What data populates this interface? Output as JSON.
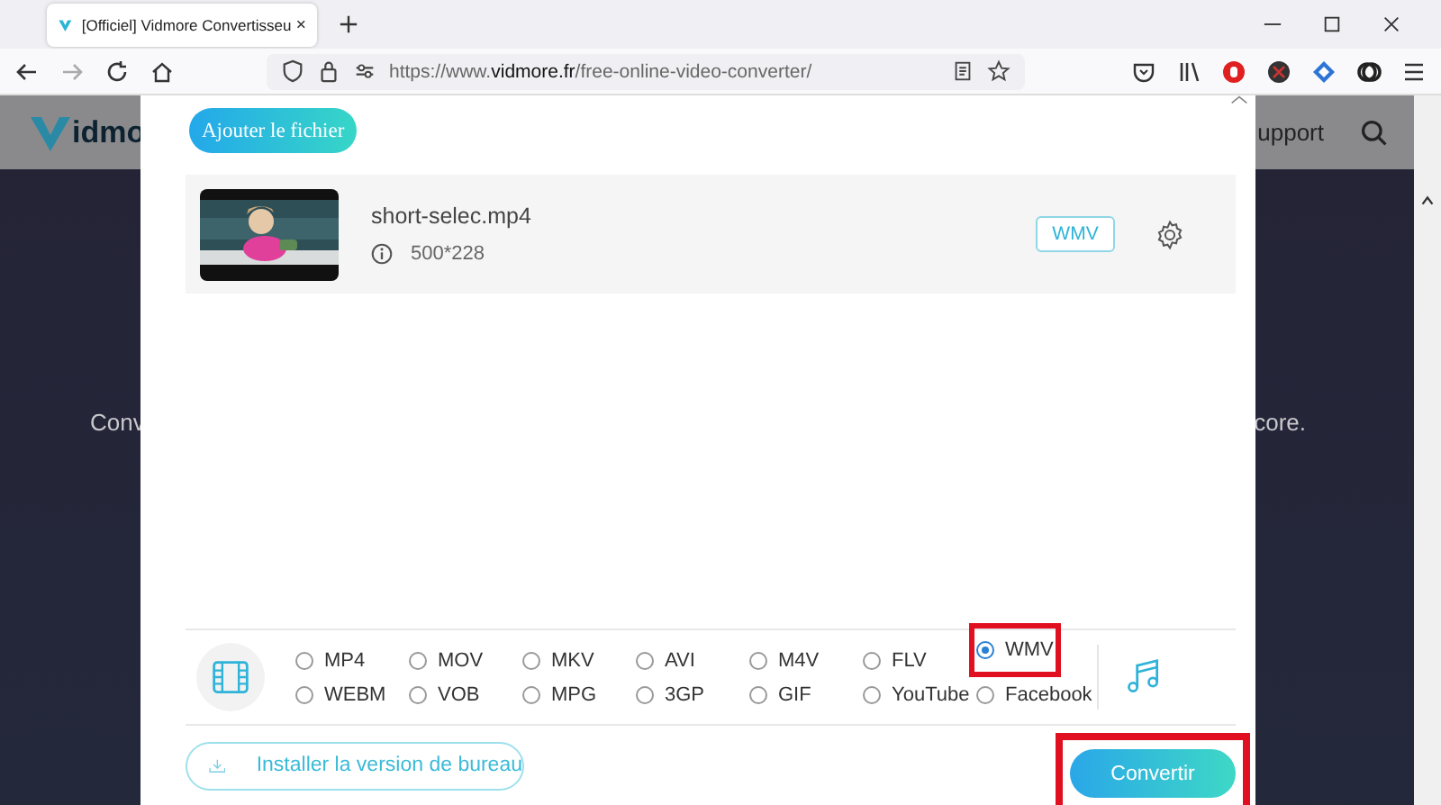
{
  "browser": {
    "tab_title": "[Officiel] Vidmore Convertisseu",
    "url_prefix": "https://www.",
    "url_domain": "vidmore.fr",
    "url_path": "/free-online-video-converter/"
  },
  "site": {
    "logo_text": "idmo",
    "nav_text": "upport",
    "left_text": "Conv",
    "right_text": "core."
  },
  "dialog": {
    "add_button": "Ajouter le fichier",
    "file": {
      "name": "short-selec.mp4",
      "resolution": "500*228",
      "format": "WMV"
    },
    "formats": [
      {
        "label": "MP4",
        "selected": false,
        "highlighted": false
      },
      {
        "label": "MOV",
        "selected": false,
        "highlighted": false
      },
      {
        "label": "MKV",
        "selected": false,
        "highlighted": false
      },
      {
        "label": "AVI",
        "selected": false,
        "highlighted": false
      },
      {
        "label": "M4V",
        "selected": false,
        "highlighted": false
      },
      {
        "label": "FLV",
        "selected": false,
        "highlighted": false
      },
      {
        "label": "WMV",
        "selected": true,
        "highlighted": true
      },
      {
        "label": "WEBM",
        "selected": false,
        "highlighted": false
      },
      {
        "label": "VOB",
        "selected": false,
        "highlighted": false
      },
      {
        "label": "MPG",
        "selected": false,
        "highlighted": false
      },
      {
        "label": "3GP",
        "selected": false,
        "highlighted": false
      },
      {
        "label": "GIF",
        "selected": false,
        "highlighted": false
      },
      {
        "label": "YouTube",
        "selected": false,
        "highlighted": false
      },
      {
        "label": "Facebook",
        "selected": false,
        "highlighted": false
      }
    ],
    "install_button": "Installer la version de bureau",
    "convert_button": {
      "label": "Convertir",
      "highlighted": true
    }
  }
}
